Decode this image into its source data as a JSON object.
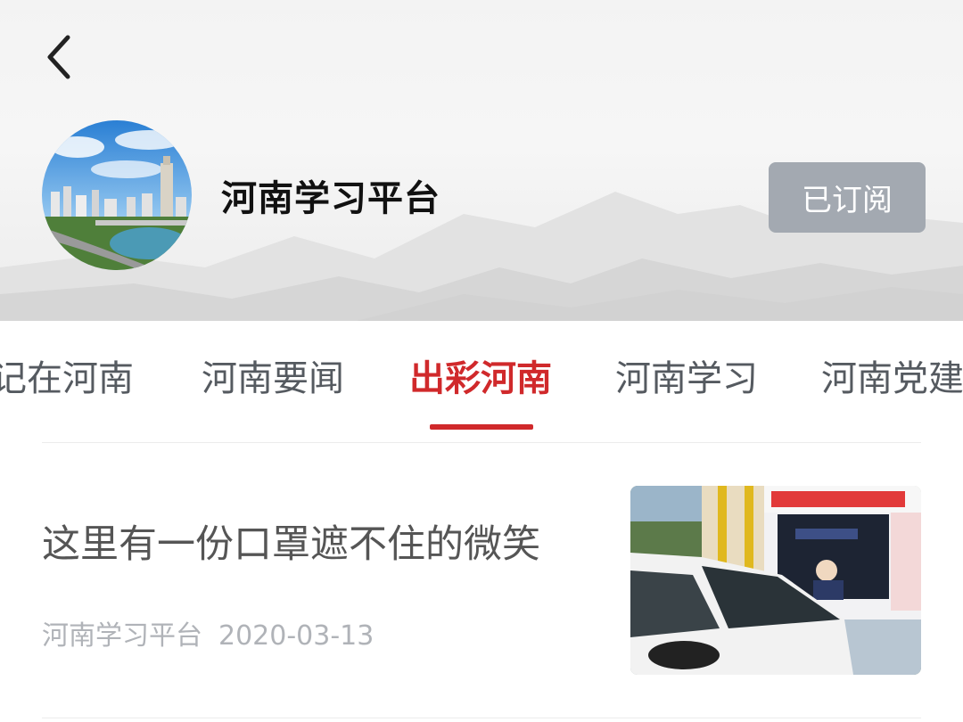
{
  "header": {
    "back_icon": "chevron-left-icon",
    "channel_title": "河南学习平台",
    "subscribe_label": "已订阅",
    "avatar_icon": "city-skyline-photo"
  },
  "tabs": [
    {
      "label": "记在河南",
      "active": false
    },
    {
      "label": "河南要闻",
      "active": false
    },
    {
      "label": "出彩河南",
      "active": true
    },
    {
      "label": "河南学习",
      "active": false
    },
    {
      "label": "河南党建",
      "active": false
    }
  ],
  "colors": {
    "accent": "#d0292b",
    "subscribe_bg": "#a3a9b1",
    "meta_text": "#b0b3b8"
  },
  "articles": [
    {
      "title": "这里有一份口罩遮不住的微笑",
      "source": "河南学习平台",
      "date": "2020-03-13",
      "thumb_icon": "toll-station-car-photo"
    }
  ]
}
